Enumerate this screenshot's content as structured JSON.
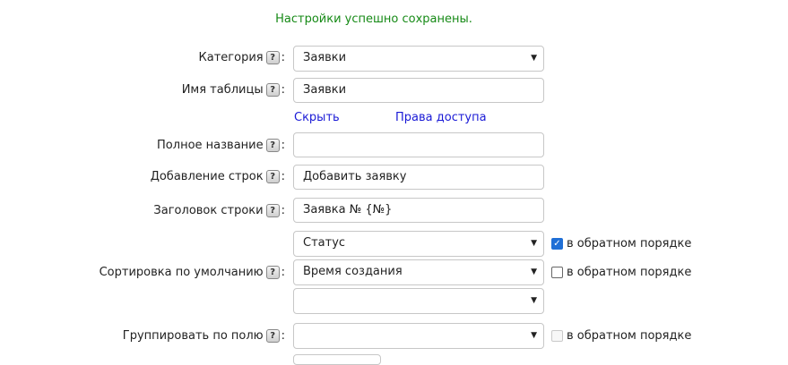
{
  "status_message": "Настройки успешно сохранены.",
  "help_glyph": "?",
  "colon": ":",
  "caret": "▼",
  "check_mark": "✓",
  "form": {
    "category": {
      "label": "Категория",
      "value": "Заявки"
    },
    "table_name": {
      "label": "Имя таблицы",
      "value": "Заявки"
    },
    "links": {
      "hide": "Скрыть",
      "access": "Права доступа"
    },
    "full_name": {
      "label": "Полное название",
      "value": ""
    },
    "add_rows": {
      "label": "Добавление строк",
      "value": "Добавить заявку"
    },
    "row_header": {
      "label": "Заголовок строки",
      "value": "Заявка № {№}"
    },
    "sorting": {
      "label": "Сортировка по умолчанию",
      "fields": [
        {
          "value": "Статус",
          "reverse_label": "в обратном порядке",
          "reverse_checked": true
        },
        {
          "value": "Время создания",
          "reverse_label": "в обратном порядке",
          "reverse_checked": false
        },
        {
          "value": ""
        }
      ]
    },
    "group_by": {
      "label": "Группировать по полю",
      "value": "",
      "reverse_label": "в обратном порядке",
      "reverse_checked": false,
      "reverse_disabled": true
    }
  }
}
